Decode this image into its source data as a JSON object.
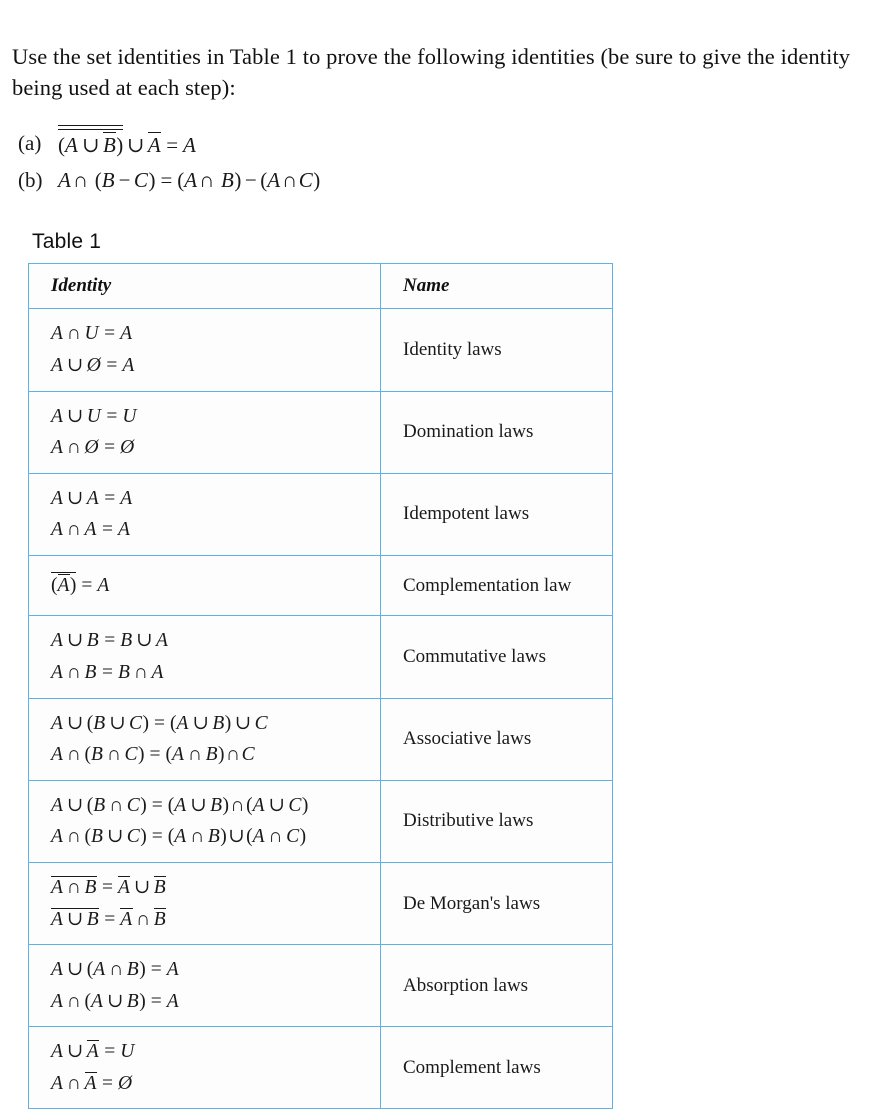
{
  "document": {
    "prompt": "Use the set identities in Table 1 to prove the following identities (be sure to give the identity being used at each step):",
    "problems": [
      {
        "label": "(a)",
        "text_plain": "((A ∪ B̄)‾)‾ ∪ Ā = A"
      },
      {
        "label": "(b)",
        "text_plain": "A ∩ (B − C) = (A ∩ B) − (A ∩ C)"
      }
    ],
    "table_caption": "Table 1",
    "table": {
      "headers": [
        "Identity",
        "Name"
      ],
      "rows": [
        {
          "name": "Identity laws",
          "identities_plain": [
            "A ∩ U = A",
            "A ∪ Ø = A"
          ]
        },
        {
          "name": "Domination laws",
          "identities_plain": [
            "A ∪ U = U",
            "A ∩ Ø = Ø"
          ]
        },
        {
          "name": "Idempotent laws",
          "identities_plain": [
            "A ∪ A = A",
            "A ∩ A = A"
          ]
        },
        {
          "name": "Complementation law",
          "identities_plain": [
            "(Ā)‾ = A"
          ]
        },
        {
          "name": "Commutative laws",
          "identities_plain": [
            "A ∪ B = B ∪ A",
            "A ∩ B = B ∩ A"
          ]
        },
        {
          "name": "Associative laws",
          "identities_plain": [
            "A ∪ (B ∪ C) = (A ∪ B) ∪ C",
            "A ∩ (B ∩ C) = (A ∩ B) ∩ C"
          ]
        },
        {
          "name": "Distributive laws",
          "identities_plain": [
            "A ∪ (B ∩ C) = (A ∪ B) ∩ (A ∪ C)",
            "A ∩ (B ∪ C) = (A ∩ B) ∪ (A ∩ C)"
          ]
        },
        {
          "name": "De Morgan's laws",
          "identities_plain": [
            "A‾∩‾B‾ = Ā ∪ B̄",
            "A‾∪‾B‾ = Ā ∩ B̄"
          ]
        },
        {
          "name": "Absorption laws",
          "identities_plain": [
            "A ∪ (A ∩ B) = A",
            "A ∩ (A ∪ B) = A"
          ]
        },
        {
          "name": "Complement laws",
          "identities_plain": [
            "A ∪ Ā = U",
            "A ∩ Ā = Ø"
          ]
        }
      ]
    },
    "symbols": {
      "union": "∪",
      "intersection": "∩",
      "empty_set": "Ø",
      "universe": "U",
      "equals": "=",
      "minus": "−"
    },
    "colors": {
      "table_border": "#5BB4E5",
      "text": "#1a1a1a",
      "background": "#ffffff"
    }
  }
}
